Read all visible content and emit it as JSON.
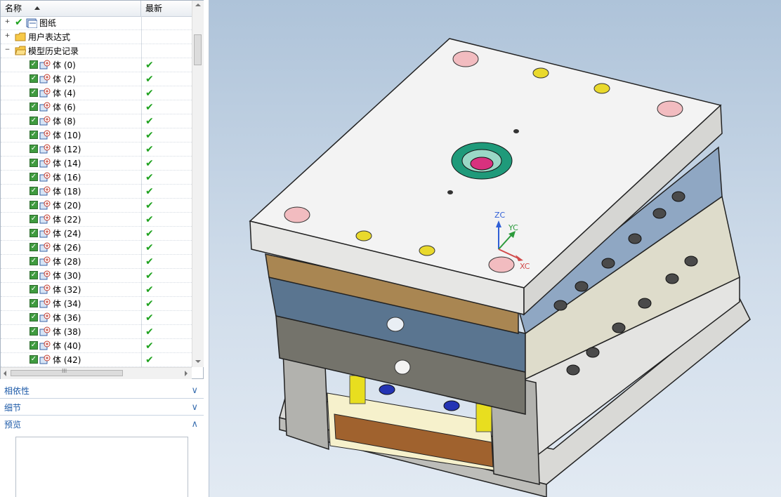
{
  "tree": {
    "col_name": "名称",
    "col_latest": "最新",
    "groups": [
      {
        "label": "图纸",
        "icon": "drawing-sheet-icon",
        "expander": "+"
      },
      {
        "label": "用户表达式",
        "icon": "folder-icon",
        "expander": "+"
      },
      {
        "label": "模型历史记录",
        "icon": "folder-open-icon",
        "expander": "−"
      }
    ],
    "bodies": [
      {
        "label": "体 (0)"
      },
      {
        "label": "体 (2)"
      },
      {
        "label": "体 (4)"
      },
      {
        "label": "体 (6)"
      },
      {
        "label": "体 (8)"
      },
      {
        "label": "体 (10)"
      },
      {
        "label": "体 (12)"
      },
      {
        "label": "体 (14)"
      },
      {
        "label": "体 (16)"
      },
      {
        "label": "体 (18)"
      },
      {
        "label": "体 (20)"
      },
      {
        "label": "体 (22)"
      },
      {
        "label": "体 (24)"
      },
      {
        "label": "体 (26)"
      },
      {
        "label": "体 (28)"
      },
      {
        "label": "体 (30)"
      },
      {
        "label": "体 (32)"
      },
      {
        "label": "体 (34)"
      },
      {
        "label": "体 (36)"
      },
      {
        "label": "体 (38)"
      },
      {
        "label": "体 (40)"
      },
      {
        "label": "体 (42)"
      }
    ],
    "latest_mark": "✔",
    "hscroll_grip": "III"
  },
  "panels": {
    "dependency": {
      "label": "相依性",
      "chevron": "∨"
    },
    "details": {
      "label": "细节",
      "chevron": "∨"
    },
    "preview": {
      "label": "预览",
      "chevron": "∧"
    }
  },
  "viewport": {
    "axis_zc": "ZC",
    "axis_yc": "YC",
    "axis_xc": "XC",
    "colors": {
      "top_plate": "#f3f3f3",
      "blue_plate": "#5a7590",
      "grey_plate": "#74736b",
      "accent_green": "#1f9a7a",
      "accent_pink": "#f2bcc0",
      "accent_yellow": "#e9d92c"
    }
  }
}
